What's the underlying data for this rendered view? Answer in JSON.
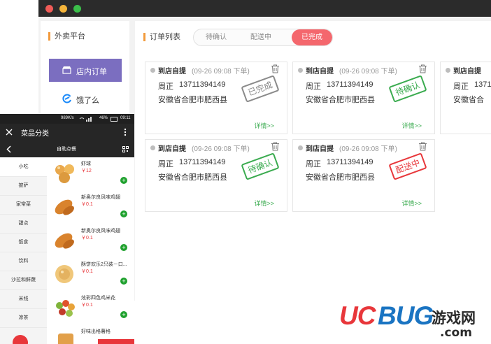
{
  "colors": {
    "accent": "#f4676d",
    "primary": "#7b6ec0",
    "stamp_green": "#3aab4f",
    "stamp_red": "#e8373b",
    "stamp_gray": "#8a8a8a",
    "logo_red": "#e8373b",
    "logo_blue": "#1a74c2"
  },
  "sidebar": {
    "title": "外卖平台",
    "items": [
      {
        "label": "店内订单",
        "icon": "store-icon",
        "active": true
      },
      {
        "label": "饿了么",
        "icon": "eleme-logo-icon",
        "active": false
      }
    ]
  },
  "main": {
    "title": "订单列表",
    "tabs": [
      {
        "label": "待确认",
        "active": false
      },
      {
        "label": "配送中",
        "active": false
      },
      {
        "label": "已完成",
        "active": true
      }
    ],
    "orders": [
      {
        "type": "到店自提",
        "time": "(09-26 09:08 下单)",
        "name": "周正",
        "phone": "13711394149",
        "address": "安徽省合肥市肥西县",
        "stamp": "已完成",
        "stamp_color": "#8a8a8a",
        "detail": "详情>>"
      },
      {
        "type": "到店自提",
        "time": "(09-26 09:08 下单)",
        "name": "周正",
        "phone": "13711394149",
        "address": "安徽省合肥市肥西县",
        "stamp": "待确认",
        "stamp_color": "#3aab4f",
        "detail": "详情>>"
      },
      {
        "type": "到店自提",
        "time": "",
        "name": "周正",
        "phone": "1371",
        "address": "安徽省合",
        "stamp": "",
        "stamp_color": "",
        "detail": ""
      },
      {
        "type": "到店自提",
        "time": "(09-26 09:08 下单)",
        "name": "周正",
        "phone": "13711394149",
        "address": "安徽省合肥市肥西县",
        "stamp": "待确认",
        "stamp_color": "#3aab4f",
        "detail": "详情>>"
      },
      {
        "type": "到店自提",
        "time": "(09-26 09:08 下单)",
        "name": "周正",
        "phone": "13711394149",
        "address": "安徽省合肥市肥西县",
        "stamp": "配送中",
        "stamp_color": "#e8373b",
        "detail": "详情>>"
      }
    ]
  },
  "phone": {
    "status": {
      "speed": "989K/s",
      "battery": "46%",
      "time": "09:11"
    },
    "title": "菜品分类",
    "subtitle": "自助点餐",
    "categories": [
      {
        "label": "小吃",
        "active": true
      },
      {
        "label": "披萨",
        "active": false
      },
      {
        "label": "家常菜",
        "active": false
      },
      {
        "label": "甜点",
        "active": false
      },
      {
        "label": "饭食",
        "active": false
      },
      {
        "label": "饮料",
        "active": false
      },
      {
        "label": "沙拉和鲜蔬",
        "active": false
      },
      {
        "label": "米线",
        "active": false
      },
      {
        "label": "凉茶",
        "active": false
      }
    ],
    "items": [
      {
        "name": "虾球",
        "price": "￥12"
      },
      {
        "name": "新奥尔良风味鸡翅",
        "price": "￥0.1"
      },
      {
        "name": "新奥尔良风味鸡翅",
        "price": "￥0.1"
      },
      {
        "name": "酥饼欢乐2只装－口...",
        "price": "￥0.1"
      },
      {
        "name": "炫彩四色鸡米花",
        "price": "￥0.1"
      },
      {
        "name": "好味出格薯格",
        "price": ""
      }
    ]
  },
  "watermark": {
    "brand_uc": "UC",
    "brand_bug": "BUG",
    "suffix": "游戏网",
    "domain": ".com"
  }
}
